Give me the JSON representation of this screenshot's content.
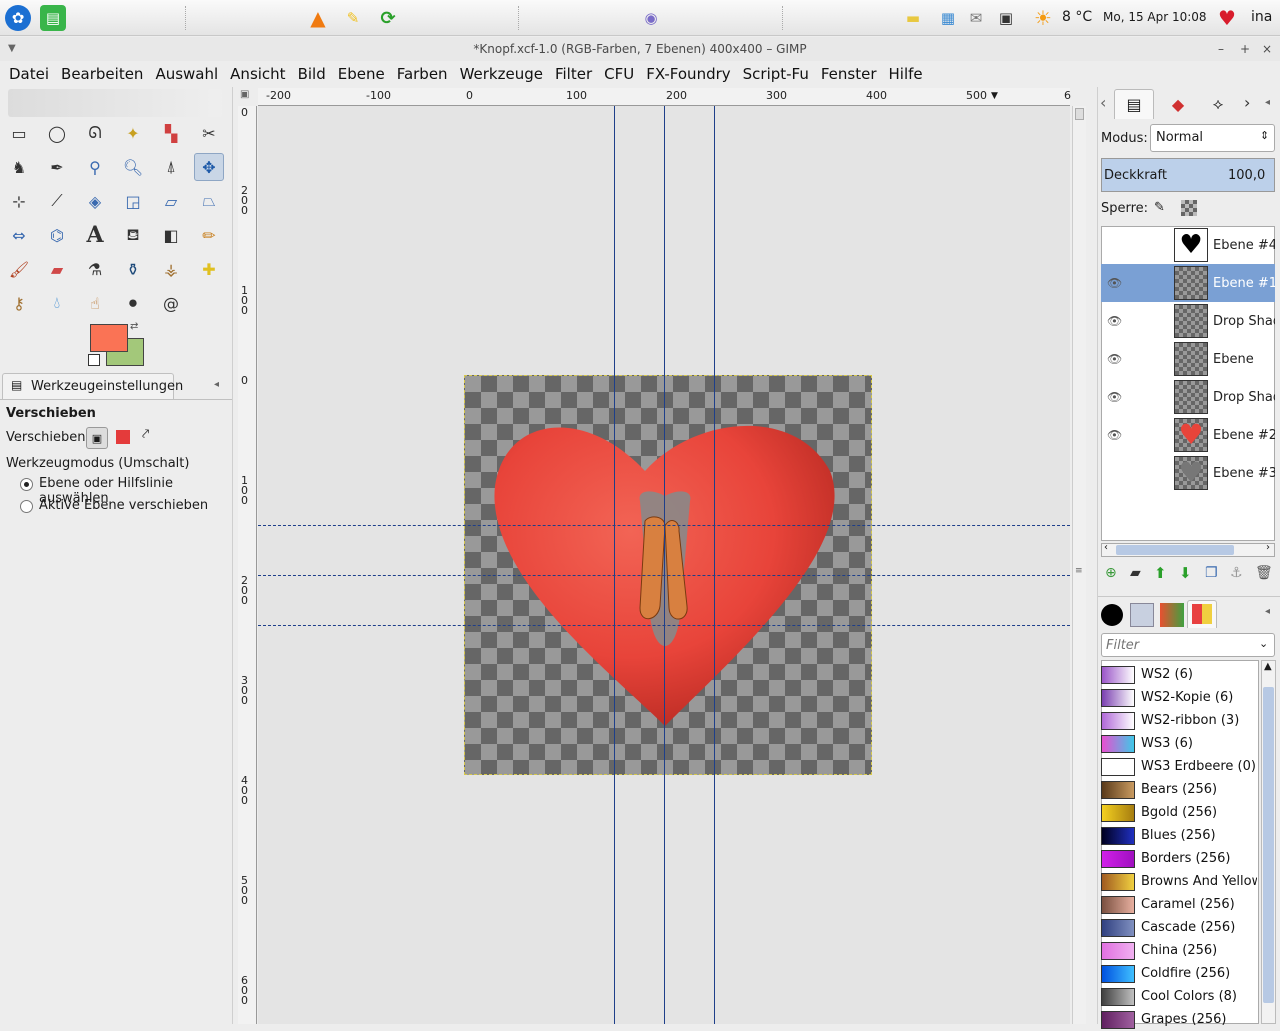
{
  "taskbar": {
    "weather": "8 °C",
    "datetime": "Mo, 15 Apr 10:08",
    "user": "ina"
  },
  "window": {
    "title": "*Knopf.xcf-1.0 (RGB-Farben, 7 Ebenen) 400x400 – GIMP",
    "controls": [
      "–",
      "+",
      "×"
    ]
  },
  "menu": [
    "Datei",
    "Bearbeiten",
    "Auswahl",
    "Ansicht",
    "Bild",
    "Ebene",
    "Farben",
    "Werkzeuge",
    "Filter",
    "CFU",
    "FX-Foundry",
    "Script-Fu",
    "Fenster",
    "Hilfe"
  ],
  "colors": {
    "fg": "#fa7355",
    "bg": "#a3c87a",
    "heart": "#e8443a",
    "selection": "#7aa0d4"
  },
  "tool_options": {
    "tab_label": "Werkzeugeinstellungen",
    "heading": "Verschieben",
    "move_label": "Verschieben:",
    "mode_label": "Werkzeugmodus (Umschalt)",
    "options": [
      "Ebene oder Hilfslinie auswählen",
      "Aktive Ebene verschieben"
    ],
    "selected_option": 0
  },
  "hruler_ticks": [
    "-200",
    "-100",
    "0",
    "100",
    "200",
    "300",
    "400",
    "500",
    "6"
  ],
  "vruler_ticks": [
    "0",
    "2 0 0",
    "1 0 0",
    "0",
    "1 0 0",
    "2 0 0",
    "3 0 0",
    "4 0 0",
    "5 0 0",
    "6 0 0"
  ],
  "layers": {
    "mode_label": "Modus:",
    "mode_value": "Normal",
    "opacity_label": "Deckkraft",
    "opacity_value": "100,0",
    "lock_label": "Sperre:",
    "items": [
      {
        "name": "Ebene #4",
        "visible": false,
        "selected": false
      },
      {
        "name": "Ebene #1",
        "visible": true,
        "selected": true
      },
      {
        "name": "Drop Shadow",
        "visible": true,
        "selected": false
      },
      {
        "name": "Ebene",
        "visible": true,
        "selected": false
      },
      {
        "name": "Drop Shadow",
        "visible": true,
        "selected": false
      },
      {
        "name": "Ebene #2",
        "visible": true,
        "selected": false
      },
      {
        "name": "Ebene #3",
        "visible": false,
        "selected": false
      }
    ]
  },
  "gradients": {
    "filter_placeholder": "Filter",
    "items": [
      {
        "name": "WS2 (6)",
        "a": "#9a55c8",
        "b": "#ffffff"
      },
      {
        "name": "WS2-Kopie (6)",
        "a": "#7a3fb0",
        "b": "#ffffff"
      },
      {
        "name": "WS2-ribbon (3)",
        "a": "#b068d8",
        "b": "#ffffff"
      },
      {
        "name": "WS3 (6)",
        "a": "#e84fd0",
        "b": "#3fc8e8"
      },
      {
        "name": "WS3 Erdbeere (0)",
        "a": "#ffffff",
        "b": "#ffffff"
      },
      {
        "name": "Bears (256)",
        "a": "#5a3a1a",
        "b": "#c89a60"
      },
      {
        "name": "Bgold (256)",
        "a": "#f4d020",
        "b": "#a67d10"
      },
      {
        "name": "Blues (256)",
        "a": "#000020",
        "b": "#2030c0"
      },
      {
        "name": "Borders (256)",
        "a": "#d020e8",
        "b": "#a010c0"
      },
      {
        "name": "Browns And Yellows",
        "a": "#a05a20",
        "b": "#f0d040"
      },
      {
        "name": "Caramel (256)",
        "a": "#7a5040",
        "b": "#e8b0a0"
      },
      {
        "name": "Cascade (256)",
        "a": "#304080",
        "b": "#8090c0"
      },
      {
        "name": "China (256)",
        "a": "#e070e0",
        "b": "#f0b0f0"
      },
      {
        "name": "Coldfire (256)",
        "a": "#0050e0",
        "b": "#40c0ff"
      },
      {
        "name": "Cool Colors (8)",
        "a": "#404040",
        "b": "#c0c0c0"
      },
      {
        "name": "Grapes (256)",
        "a": "#602060",
        "b": "#a060a0"
      }
    ]
  }
}
